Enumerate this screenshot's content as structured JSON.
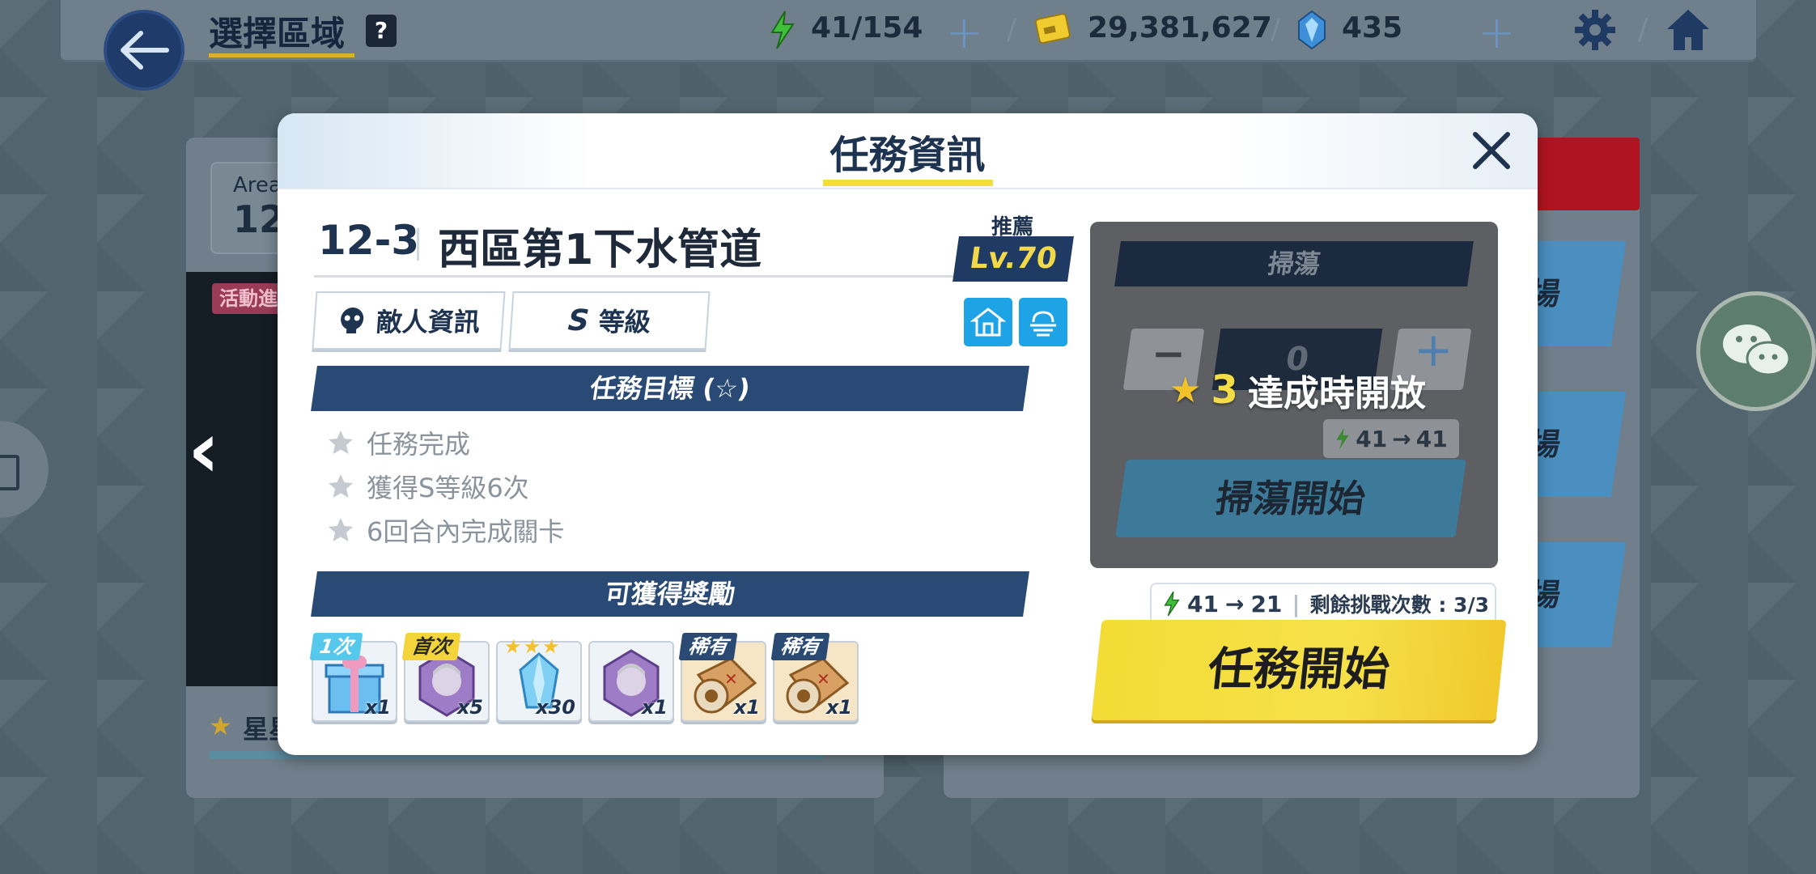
{
  "topbar": {
    "title": "選擇區域",
    "help": "?",
    "stamina": "41/154",
    "credits": "29,381,627",
    "gems": "435"
  },
  "background": {
    "area_label": "Area",
    "area_num": "12",
    "event_tag": "活動進",
    "star_text": "星星",
    "stage_buttons": [
      "場",
      "場",
      "場"
    ]
  },
  "modal": {
    "title": "任務資訊",
    "stage_code": "12-3",
    "stage_name": "西區第1下水管道",
    "recommend_label": "推薦",
    "level": "Lv.70",
    "tab_enemy": "敵人資訊",
    "tab_grade_letter": "S",
    "tab_grade": "等級",
    "objectives_title": "任務目標 (☆)",
    "objectives": [
      "任務完成",
      "獲得S等級6次",
      "6回合內完成關卡"
    ],
    "rewards_title": "可獲得獎勵",
    "rewards": [
      {
        "tag": "1次",
        "qty": "x1",
        "icon": "gift-box-icon"
      },
      {
        "tag": "首次",
        "qty": "x5",
        "icon": "character-token-icon"
      },
      {
        "tag": "★★★",
        "qty": "x30",
        "icon": "crystal-icon"
      },
      {
        "tag": "",
        "qty": "x1",
        "icon": "character-token-icon"
      },
      {
        "tag": "稀有",
        "qty": "x1",
        "icon": "pizza-box-icon"
      },
      {
        "tag": "稀有",
        "qty": "x1",
        "icon": "pizza-box-icon"
      }
    ],
    "sweep": {
      "title": "掃蕩",
      "minus": "−",
      "count": "0",
      "plus": "+",
      "unlock_stars": "3",
      "unlock_text": "達成時開放",
      "ap_from": "41",
      "ap_to": "41",
      "start_label": "掃蕩開始"
    },
    "start": {
      "ap_from": "41",
      "ap_to": "21",
      "remaining_label": "剩餘挑戰次數 : 3/3",
      "label": "任務開始"
    }
  },
  "colors": {
    "accent_yellow": "#f3dc35",
    "navy": "#294a74",
    "env_blue": "#1ea3e6"
  }
}
